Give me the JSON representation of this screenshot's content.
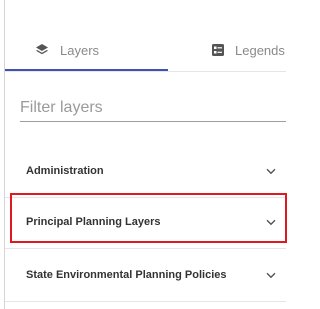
{
  "tabs": [
    {
      "label": "Layers",
      "icon": "layers-icon",
      "active": true
    },
    {
      "label": "Legends",
      "icon": "legend-icon",
      "active": false
    }
  ],
  "filter": {
    "placeholder": "Filter layers",
    "value": ""
  },
  "groups": [
    {
      "label": "Administration",
      "icon": "chevron-down-icon"
    },
    {
      "label": "Principal Planning Layers",
      "icon": "chevron-down-icon",
      "highlighted": true
    },
    {
      "label": "State Environmental Planning Policies",
      "icon": "chevron-down-icon"
    }
  ],
  "colors": {
    "accent": "#3f51b5",
    "highlight": "#e0191f",
    "text": "#333333",
    "muted": "#8a8a8a"
  }
}
